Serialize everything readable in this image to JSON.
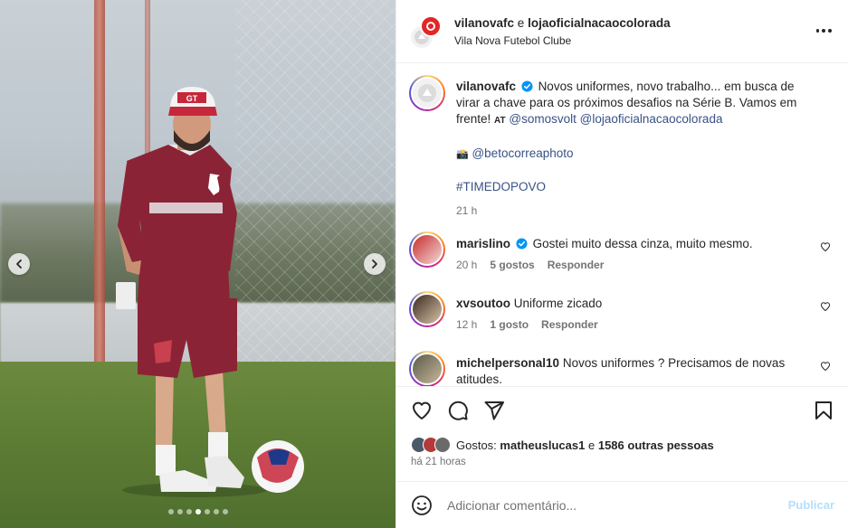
{
  "post": {
    "image_alt": "Treinador com uniforme vinho e boné no gramado de treino",
    "carousel": {
      "count": 7,
      "active_index": 3
    }
  },
  "header": {
    "account1": "vilanovafc",
    "joiner": "e",
    "account2": "lojaoficialnacaocolorada",
    "subtitle": "Vila Nova Futebol Clube"
  },
  "caption": {
    "username": "vilanovafc",
    "text": "Novos uniformes, novo trabalho... em busca de virar a chave para os próximos desafios na Série B. Vamos em frente!",
    "at_label": "AT",
    "mention1": "@somosvolt",
    "mention2": "@lojaoficialnacaocolorada",
    "camera_emoji": "📸",
    "photo_credit": "@betocorreaphoto",
    "hashtag": "#TIMEDOPOVO",
    "time": "21 h"
  },
  "comments": [
    {
      "username": "marislino",
      "verified": true,
      "text": "Gostei muito dessa cinza, muito mesmo.",
      "time": "20 h",
      "likes": "5 gostos",
      "reply": "Responder"
    },
    {
      "username": "xvsoutoo",
      "verified": false,
      "text": "Uniforme zicado",
      "time": "12 h",
      "likes": "1 gosto",
      "reply": "Responder"
    },
    {
      "username": "michelpersonal10",
      "verified": false,
      "text": "Novos uniformes ? Precisamos de novas atitudes."
    }
  ],
  "likes": {
    "prefix": "Gostos:",
    "user": "matheuslucas1",
    "joiner": "e",
    "others": "1586 outras pessoas"
  },
  "timeago": "há 21 horas",
  "composer": {
    "placeholder": "Adicionar comentário...",
    "publish": "Publicar"
  },
  "colors": {
    "text": "#262626",
    "secondary": "#737373",
    "link": "#385185",
    "verified": "#0095f6",
    "publish_disabled": "#b2dffc",
    "jersey": "#8b2336"
  },
  "icons": [
    "more-options-icon",
    "verified-icon",
    "heart-icon",
    "comment-icon",
    "share-icon",
    "bookmark-icon",
    "emoji-icon",
    "chevron-left-icon",
    "chevron-right-icon"
  ]
}
